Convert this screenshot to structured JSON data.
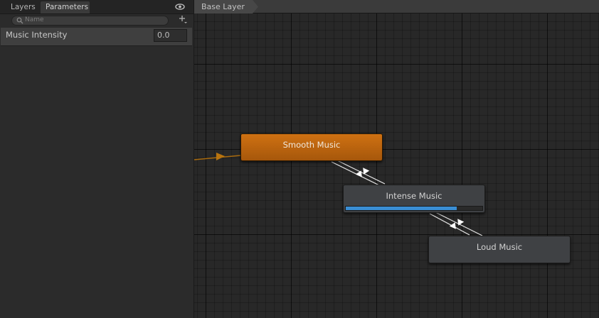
{
  "tabs": [
    {
      "label": "Layers",
      "active": false
    },
    {
      "label": "Parameters",
      "active": true
    }
  ],
  "search": {
    "placeholder": "Name"
  },
  "parameters": [
    {
      "name": "Music Intensity",
      "value": "0.0"
    }
  ],
  "breadcrumb": {
    "layer": "Base Layer"
  },
  "states": {
    "smooth": {
      "label": "Smooth Music",
      "is_default": true,
      "color": "#c86b10"
    },
    "intense": {
      "label": "Intense Music",
      "progress": 0.81,
      "progress_color": "#3a8ed4"
    },
    "loud": {
      "label": "Loud Music"
    }
  },
  "icons": {
    "visibility": "eye-icon",
    "search": "search-icon",
    "add_parameter": "plus-dropdown-icon"
  },
  "colors": {
    "default_state": "#c86b10",
    "entry_transition": "#a86a0e",
    "transition": "#e6e6e6",
    "graph_background": "#282828"
  }
}
